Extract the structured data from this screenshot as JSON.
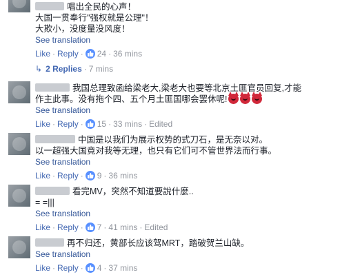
{
  "comments": [
    {
      "text_lines": [
        "唱出全民的心声！",
        "大国一贯奉行\"强权就是公理\"！",
        "大欺小，没度量没风度！"
      ],
      "see_translation": "See translation",
      "like": "Like",
      "reply": "Reply",
      "like_count": "24",
      "time": "36 mins",
      "edited": ""
    },
    {
      "text_lines": [
        "我国总理致函给梁老大,梁老大也要等北京土匪官员回复,才能",
        "作主此事。没有拖个四、五个月土匪国哪会罢休呢!"
      ],
      "see_translation": "See translation",
      "like": "Like",
      "reply": "Reply",
      "like_count": "15",
      "time": "33 mins",
      "edited": "Edited"
    },
    {
      "text_lines": [
        "中国是以我们为展示权势的式刀石，是无奈以对。",
        "以一超强大国竟对我等无理，也只有它们可不管世界法而行事。"
      ],
      "see_translation": "See translation",
      "like": "Like",
      "reply": "Reply",
      "like_count": "9",
      "time": "36 mins",
      "edited": ""
    },
    {
      "text_lines": [
        "看完MV，突然不知道要說什麼..",
        "= =|||"
      ],
      "see_translation": "See translation",
      "like": "Like",
      "reply": "Reply",
      "like_count": "7",
      "time": "41 mins",
      "edited": "Edited"
    },
    {
      "text_lines": [
        "再不归还，黄部长应该驾MRT，踏破贺兰山缺。"
      ],
      "see_translation": "See translation",
      "like": "Like",
      "reply": "Reply",
      "like_count": "4",
      "time": "37 mins",
      "edited": ""
    }
  ],
  "replies_thread": {
    "label": "2 Replies",
    "time": "7 mins"
  },
  "colors": {
    "link": "#4267b2",
    "translation": "#365899",
    "meta": "#90949c",
    "like_badge": "#5890ff",
    "devil": "#d1283a"
  }
}
